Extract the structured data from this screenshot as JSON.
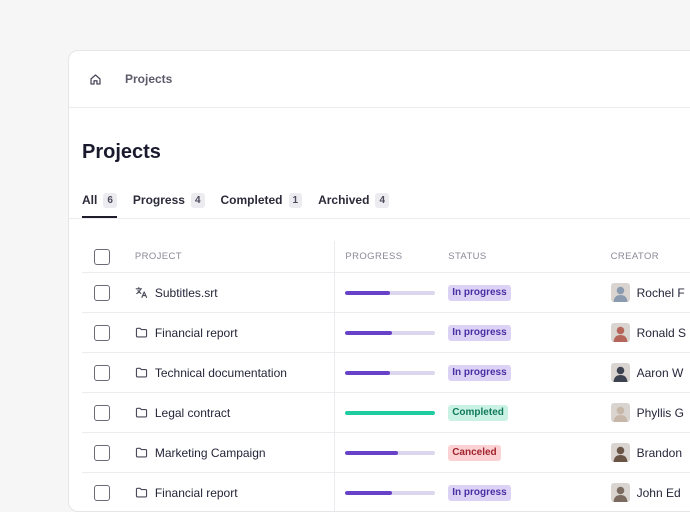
{
  "breadcrumb": {
    "label": "Projects",
    "icon": "home-icon"
  },
  "page": {
    "title": "Projects"
  },
  "tabs": [
    {
      "label": "All",
      "count": "6",
      "active": true
    },
    {
      "label": "Progress",
      "count": "4",
      "active": false
    },
    {
      "label": "Completed",
      "count": "1",
      "active": false
    },
    {
      "label": "Archived",
      "count": "4",
      "active": false
    }
  ],
  "table": {
    "headers": {
      "project": "PROJECT",
      "progress": "PROGRESS",
      "status": "STATUS",
      "creator": "CREATOR"
    },
    "rows": [
      {
        "icon": "translate-icon",
        "project": "Subtitles.srt",
        "progress": 0.5,
        "status": "In progress",
        "status_key": "in_progress",
        "creator": "Rochel F",
        "avatar_color": "#8a9bb0"
      },
      {
        "icon": "folder-icon",
        "project": "Financial report",
        "progress": 0.52,
        "status": "In progress",
        "status_key": "in_progress",
        "creator": "Ronald S",
        "avatar_color": "#b5655a"
      },
      {
        "icon": "folder-icon",
        "project": "Technical documentation",
        "progress": 0.5,
        "status": "In progress",
        "status_key": "in_progress",
        "creator": "Aaron W",
        "avatar_color": "#3d4250"
      },
      {
        "icon": "folder-icon",
        "project": "Legal contract",
        "progress": 1.0,
        "status": "Completed",
        "status_key": "completed",
        "creator": "Phyllis G",
        "avatar_color": "#c7b7a8"
      },
      {
        "icon": "folder-icon",
        "project": "Marketing Campaign",
        "progress": 0.58,
        "status": "Canceled",
        "status_key": "canceled",
        "creator": "Brandon",
        "avatar_color": "#6a5446"
      },
      {
        "icon": "folder-icon",
        "project": "Financial report",
        "progress": 0.52,
        "status": "In progress",
        "status_key": "in_progress",
        "creator": "John Ed",
        "avatar_color": "#7a6a60"
      }
    ]
  },
  "colors": {
    "progress_fill": "#6741c7",
    "progress_complete": "#1fcca0",
    "progress_track": "#ddd6ef",
    "in_progress_bg": "#dcd2f5",
    "in_progress_fg": "#4a2fa3",
    "completed_bg": "#c9f2e4",
    "completed_fg": "#11795a",
    "canceled_bg": "#fbd1d3",
    "canceled_fg": "#a1232d"
  }
}
